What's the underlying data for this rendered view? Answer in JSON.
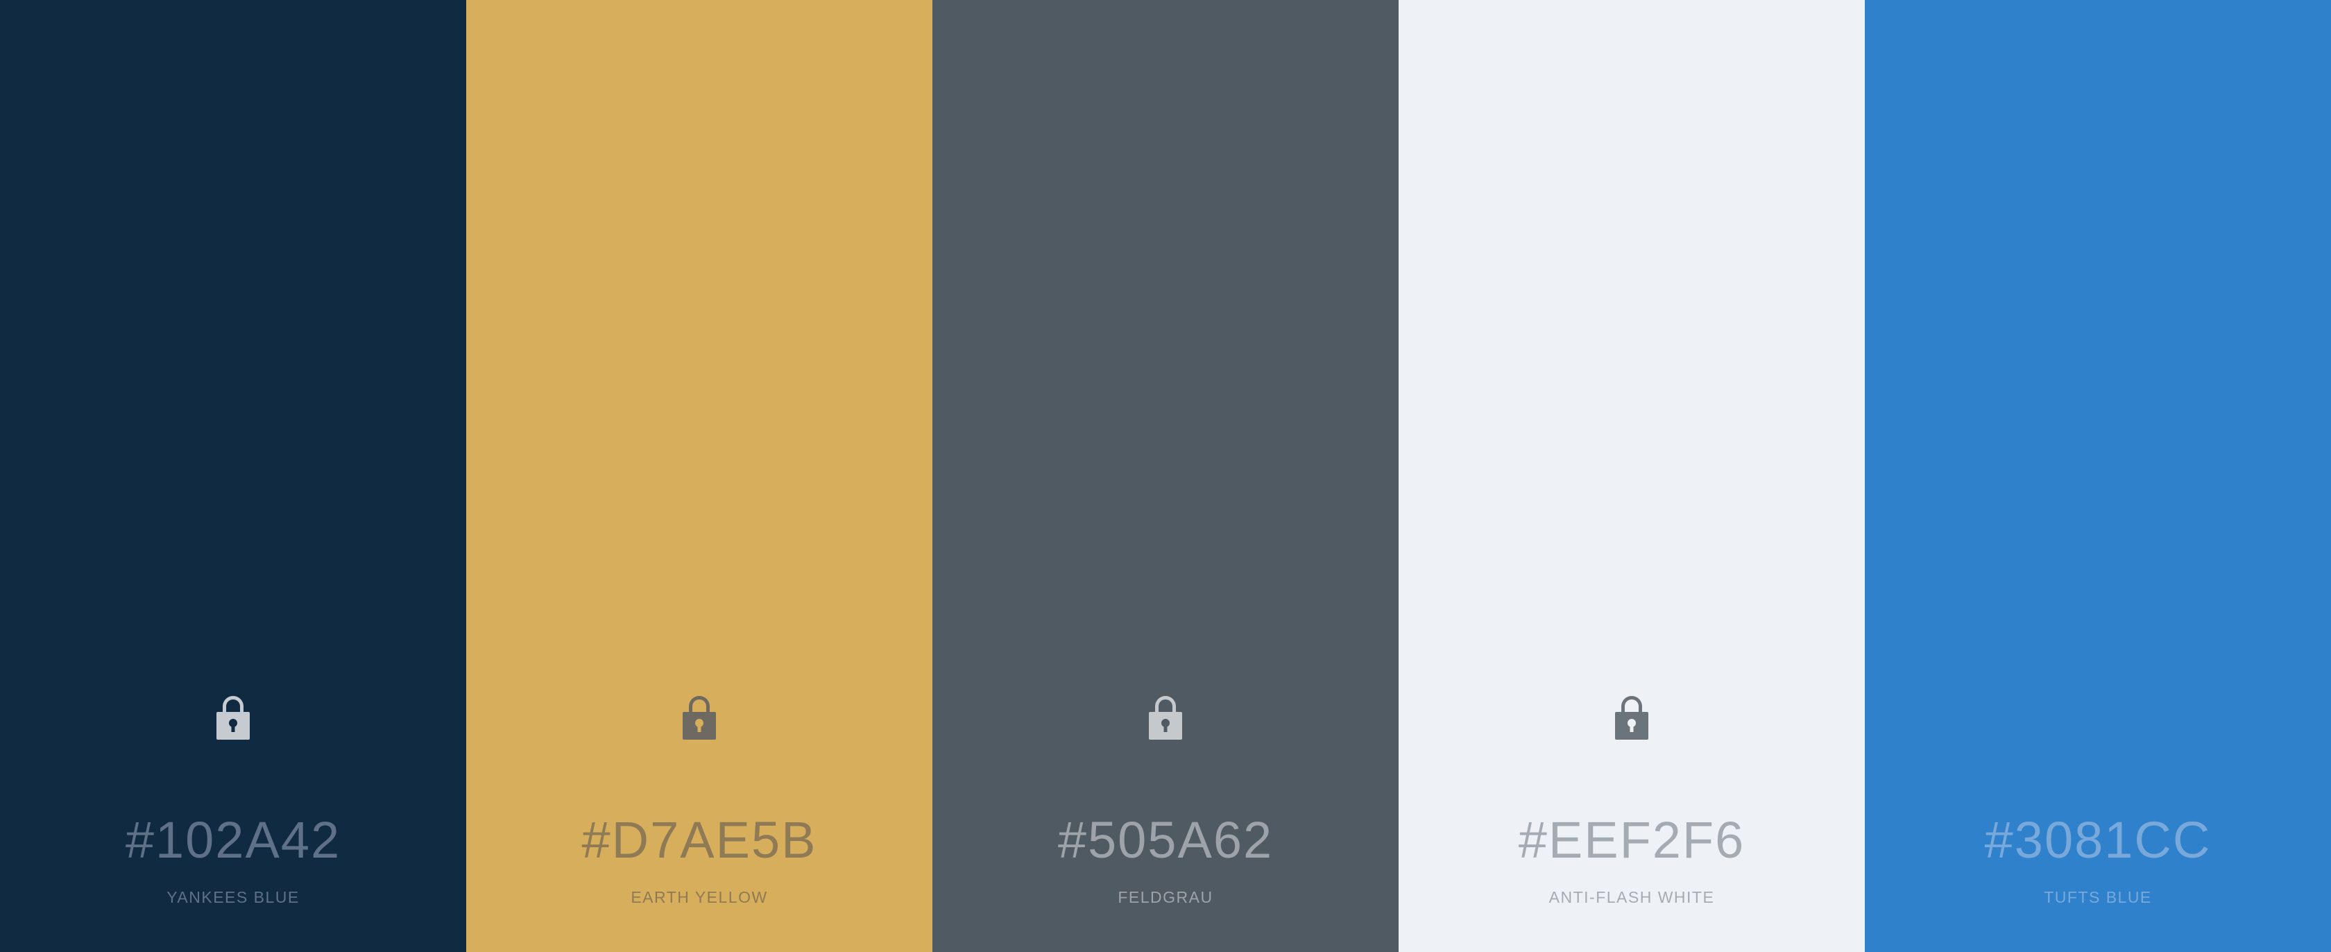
{
  "palette": {
    "swatches": [
      {
        "hex": "#102A42",
        "name": "YANKEES BLUE",
        "color": "#102A42",
        "locked_icon": "lock-icon"
      },
      {
        "hex": "#D7AE5B",
        "name": "EARTH YELLOW",
        "color": "#D7AE5B",
        "locked_icon": "lock-icon"
      },
      {
        "hex": "#505A62",
        "name": "FELDGRAU",
        "color": "#505A62",
        "locked_icon": "lock-icon"
      },
      {
        "hex": "#EEF2F6",
        "name": "ANTI-FLASH WHITE",
        "color": "#EEF2F6",
        "locked_icon": "lock-icon"
      },
      {
        "hex": "#3081CC",
        "name": "TUFTS BLUE",
        "color": "#3081CC"
      }
    ]
  }
}
